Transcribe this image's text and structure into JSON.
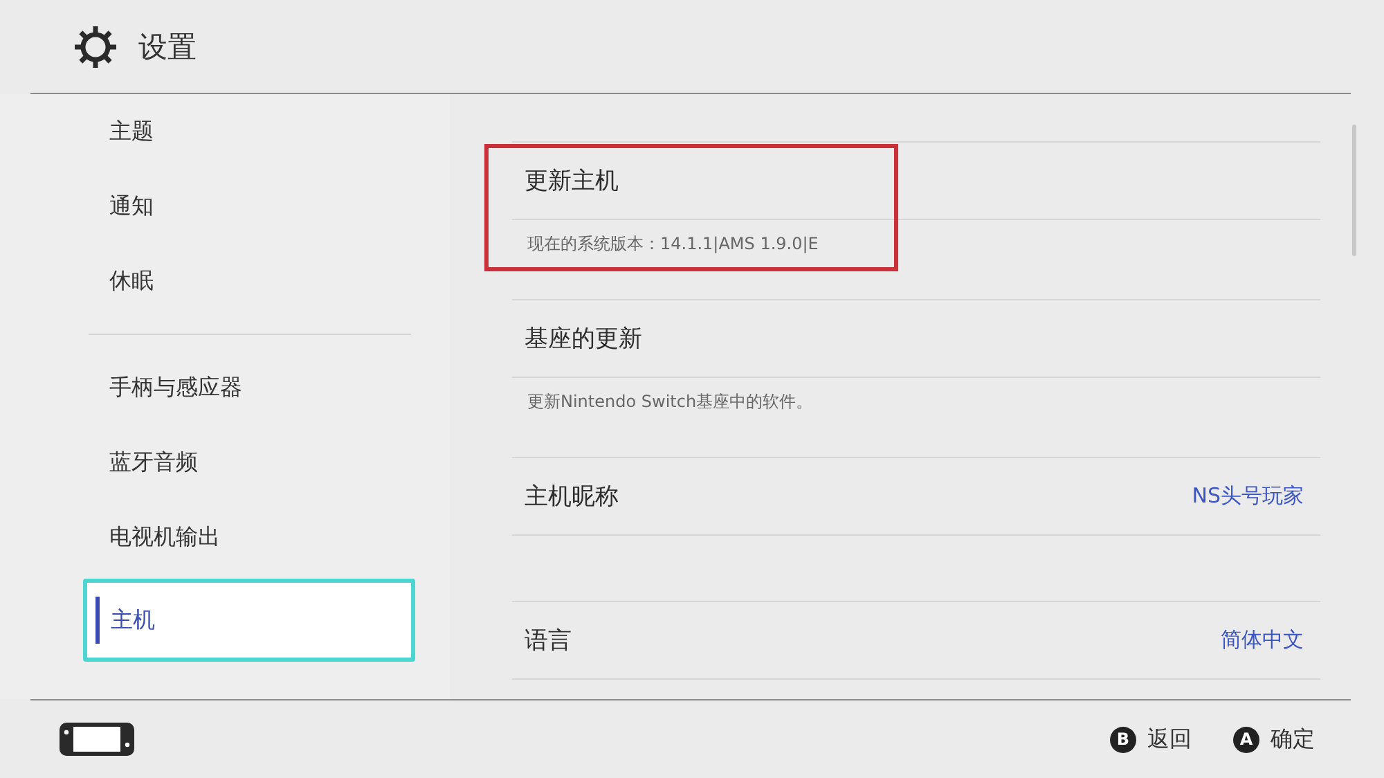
{
  "header": {
    "title": "设置"
  },
  "sidebar": {
    "groups": [
      [
        {
          "label": "主题",
          "selected": false
        },
        {
          "label": "通知",
          "selected": false
        },
        {
          "label": "休眠",
          "selected": false
        }
      ],
      [
        {
          "label": "手柄与感应器",
          "selected": false
        },
        {
          "label": "蓝牙音频",
          "selected": false
        },
        {
          "label": "电视机输出",
          "selected": false
        },
        {
          "label": "主机",
          "selected": true
        }
      ]
    ]
  },
  "content": {
    "groups": [
      [
        {
          "title": "更新主机",
          "note": "现在的系统版本：14.1.1|AMS 1.9.0|E",
          "highlighted": true
        },
        {
          "title": "基座的更新",
          "note": "更新Nintendo Switch基座中的软件。",
          "highlighted": false
        },
        {
          "title": "主机昵称",
          "value": "NS头号玩家",
          "highlighted": false
        }
      ],
      [
        {
          "title": "语言",
          "value": "简体中文",
          "highlighted": false
        }
      ]
    ]
  },
  "footer": {
    "buttons": [
      {
        "key": "B",
        "label": "返回"
      },
      {
        "key": "A",
        "label": "确定"
      }
    ]
  }
}
